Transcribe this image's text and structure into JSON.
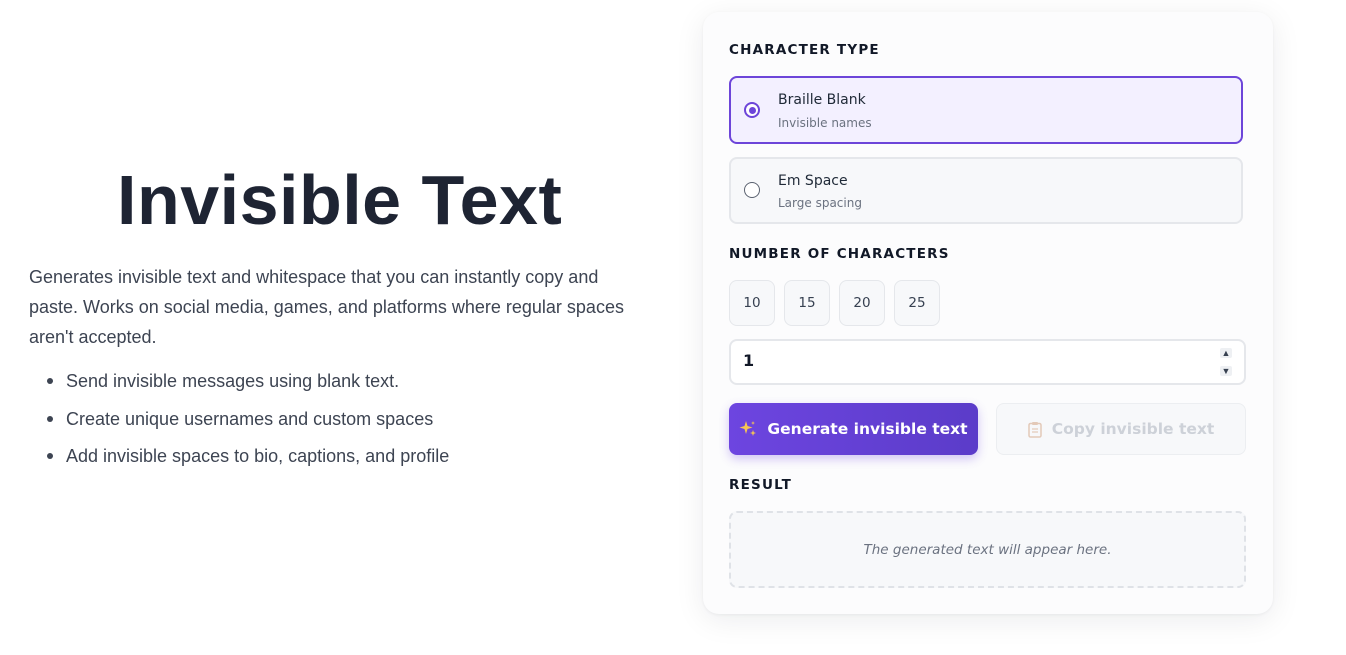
{
  "hero": {
    "title": "Invisible Text",
    "description": "Generates invisible text and whitespace that you can instantly copy and paste. Works on social media, games, and platforms where regular spaces aren't accepted.",
    "bullets": [
      "Send invisible messages using blank text.",
      "Create unique usernames and custom spaces",
      "Add invisible spaces to bio, captions, and profile"
    ]
  },
  "generator": {
    "character_type_label": "CHARACTER TYPE",
    "options": [
      {
        "title": "Braille Blank",
        "subtitle": "Invisible names",
        "selected": true
      },
      {
        "title": "Em Space",
        "subtitle": "Large spacing",
        "selected": false
      }
    ],
    "number_label": "NUMBER OF CHARACTERS",
    "presets": [
      "10",
      "15",
      "20",
      "25"
    ],
    "count_value": "1",
    "spin_up": "▲",
    "spin_down": "▼",
    "generate_icon": "sparkles-icon",
    "generate_label": "Generate invisible text",
    "copy_icon": "clipboard-icon",
    "copy_label": "Copy invisible text",
    "result_label": "RESULT",
    "result_placeholder": "The generated text will appear here."
  },
  "colors": {
    "accent": "#6d45d9",
    "title": "#1e2433",
    "selected_bg": "#f3f0ff"
  }
}
